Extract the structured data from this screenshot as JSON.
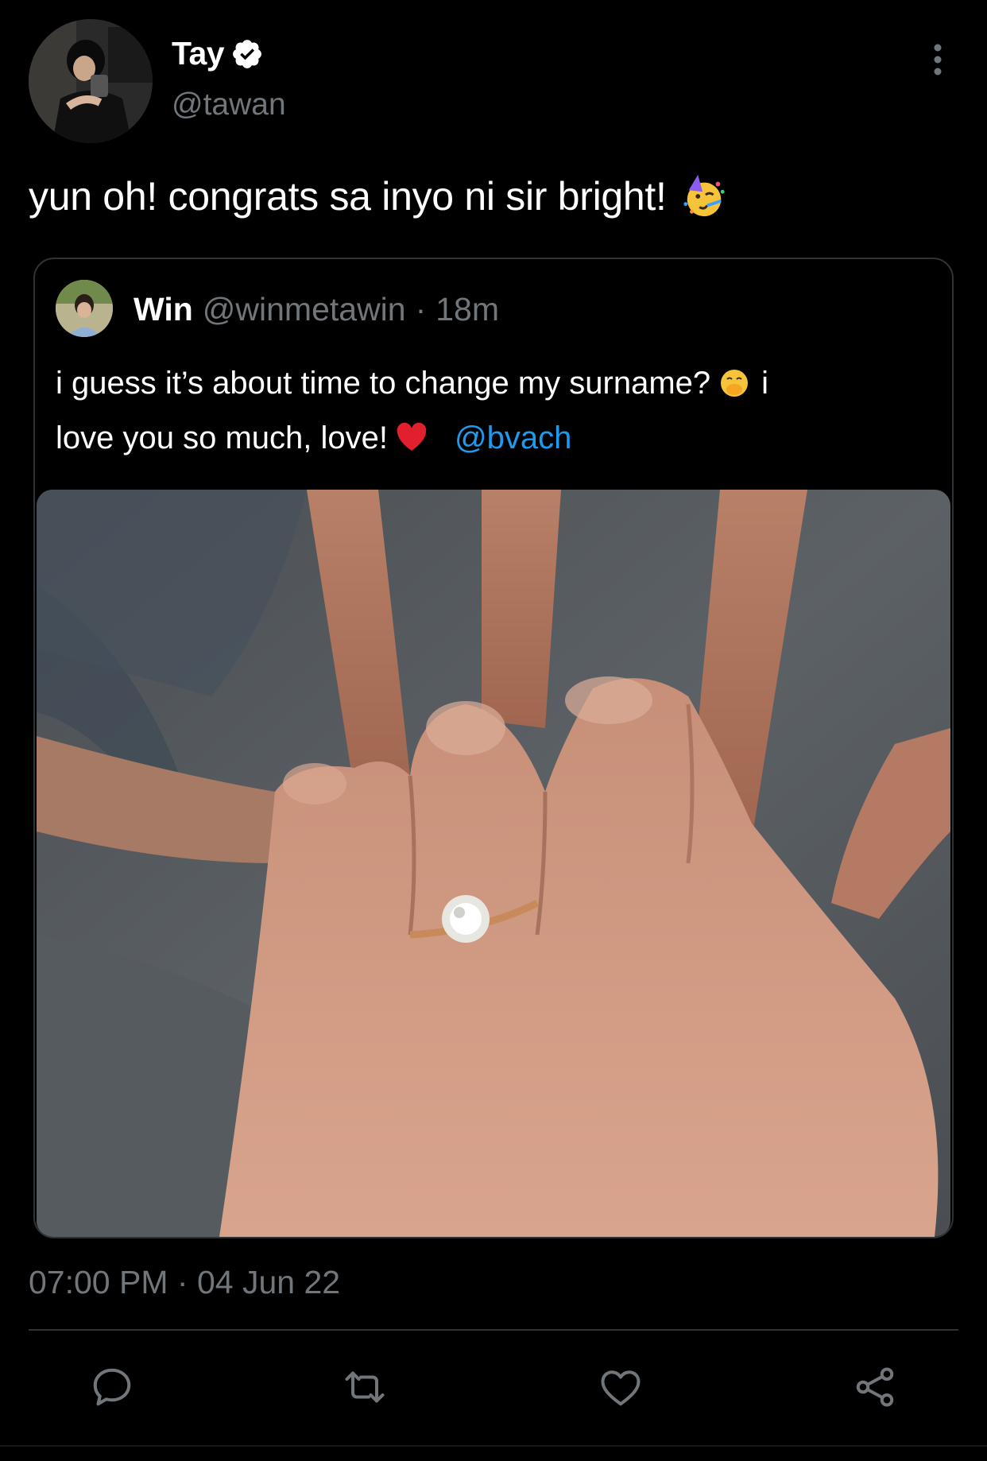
{
  "author": {
    "display_name": "Tay",
    "handle": "@tawan",
    "verified": true,
    "avatar_icon": "profile-photo"
  },
  "tweet": {
    "text": "yun oh! congrats sa inyo ni sir bright!",
    "emoji": "partying-face"
  },
  "quoted_tweet": {
    "display_name": "Win",
    "handle": "@winmetawin",
    "separator": "·",
    "time_ago": "18m",
    "text_part1": "i guess it’s about time to change my surname?",
    "emoji_1": "face-with-hand-over-mouth",
    "text_part2": "i",
    "text_part3": "love you so much, love!",
    "emoji_2": "red-heart",
    "mention": "@bvach",
    "image": "photo-ring-hands"
  },
  "meta": {
    "time": "07:00 PM",
    "separator": "·",
    "date": "04 Jun 22"
  },
  "actions": [
    {
      "name": "reply",
      "icon": "reply-icon"
    },
    {
      "name": "retweet",
      "icon": "retweet-icon"
    },
    {
      "name": "like",
      "icon": "heart-icon"
    },
    {
      "name": "share",
      "icon": "share-icon"
    }
  ],
  "colors": {
    "background": "#000000",
    "text": "#ffffff",
    "secondary_text": "#71767b",
    "link": "#1d9bf0",
    "border": "#2f3336"
  }
}
